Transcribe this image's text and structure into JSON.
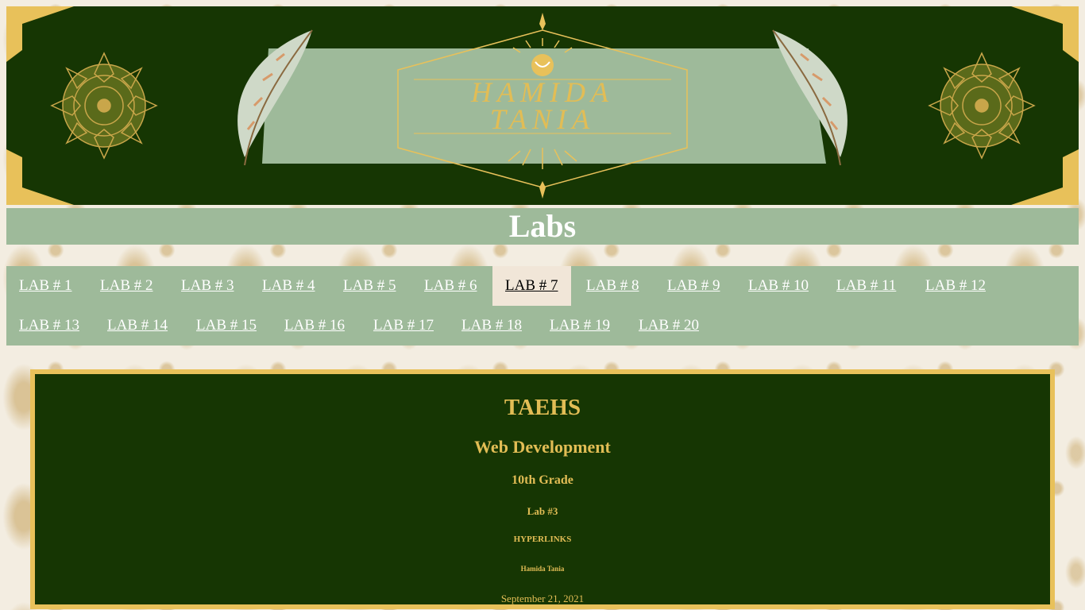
{
  "banner": {
    "logo_line1": "HAMIDA",
    "logo_line2": "TANIA",
    "colors": {
      "background": "#163603",
      "gold": "#e8c15a",
      "ribbon": "#9eba9a"
    }
  },
  "page_title": "Labs",
  "nav": {
    "items": [
      {
        "label": "LAB # 1",
        "active": false
      },
      {
        "label": "LAB # 2",
        "active": false
      },
      {
        "label": "LAB # 3",
        "active": false
      },
      {
        "label": "LAB # 4",
        "active": false
      },
      {
        "label": "LAB # 5",
        "active": false
      },
      {
        "label": "LAB # 6",
        "active": false
      },
      {
        "label": "LAB # 7",
        "active": true
      },
      {
        "label": "LAB # 8",
        "active": false
      },
      {
        "label": "LAB # 9",
        "active": false
      },
      {
        "label": "LAB # 10",
        "active": false
      },
      {
        "label": "LAB # 11",
        "active": false
      },
      {
        "label": "LAB # 12",
        "active": false
      },
      {
        "label": "LAB # 13",
        "active": false
      },
      {
        "label": "LAB # 14",
        "active": false
      },
      {
        "label": "LAB # 15",
        "active": false
      },
      {
        "label": "LAB # 16",
        "active": false
      },
      {
        "label": "LAB # 17",
        "active": false
      },
      {
        "label": "LAB # 18",
        "active": false
      },
      {
        "label": "LAB # 19",
        "active": false
      },
      {
        "label": "LAB # 20",
        "active": false
      }
    ]
  },
  "content": {
    "school": "TAEHS",
    "course": "Web Development",
    "grade": "10th Grade",
    "lab": "Lab #3",
    "topic": "HYPERLINKS",
    "author": "Hamida Tania",
    "date": "September 21, 2021"
  },
  "colors": {
    "dark_green": "#163603",
    "sage": "#9eba9a",
    "gold": "#e8c15a",
    "text_gold": "#e2bd55",
    "active_tab": "#f1e6d8"
  }
}
